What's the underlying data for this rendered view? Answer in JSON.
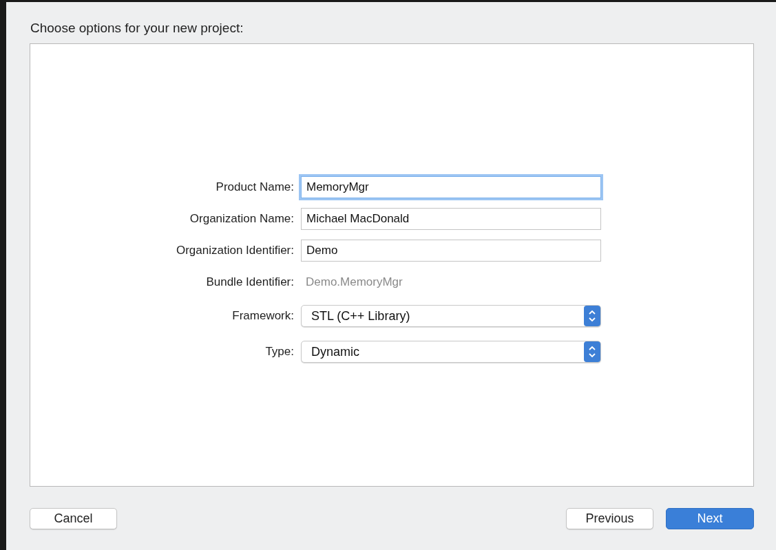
{
  "heading": "Choose options for your new project:",
  "fields": [
    {
      "kind": "text",
      "label": "Product Name:",
      "value": "MemoryMgr",
      "focused": true
    },
    {
      "kind": "text",
      "label": "Organization Name:",
      "value": "Michael MacDonald",
      "focused": false
    },
    {
      "kind": "text",
      "label": "Organization Identifier:",
      "value": "Demo",
      "focused": false
    },
    {
      "kind": "readonly",
      "label": "Bundle Identifier:",
      "value": "Demo.MemoryMgr"
    },
    {
      "kind": "popup",
      "label": "Framework:",
      "value": "STL (C++ Library)"
    },
    {
      "kind": "popup",
      "label": "Type:",
      "value": "Dynamic"
    }
  ],
  "buttons": [
    {
      "label": "Cancel",
      "default": false
    },
    {
      "label": "Previous",
      "default": false
    },
    {
      "label": "Next",
      "default": true
    }
  ]
}
